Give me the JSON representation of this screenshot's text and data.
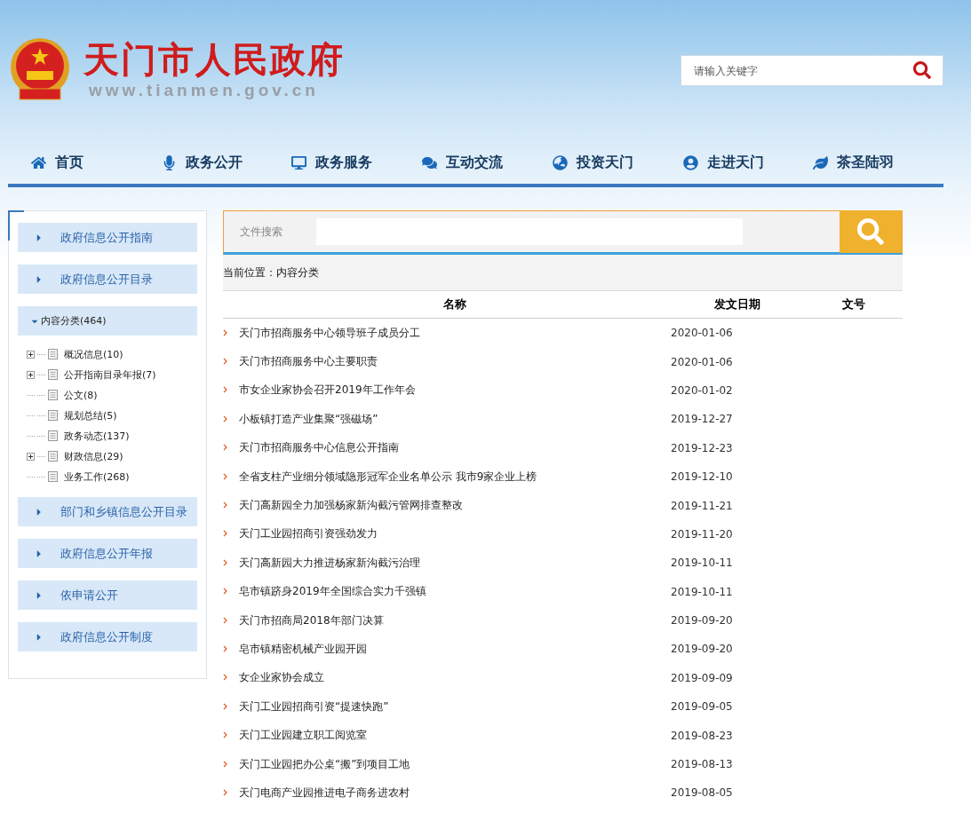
{
  "header": {
    "title": "天门市人民政府",
    "url": "www.tianmen.gov.cn",
    "search": {
      "placeholder": "请输入关键字"
    }
  },
  "nav": [
    {
      "label": "首页"
    },
    {
      "label": "政务公开"
    },
    {
      "label": "政务服务"
    },
    {
      "label": "互动交流"
    },
    {
      "label": "投资天门"
    },
    {
      "label": "走进天门"
    },
    {
      "label": "茶圣陆羽"
    }
  ],
  "sidebar": {
    "sections": [
      {
        "kind": "link",
        "label": "政府信息公开指南"
      },
      {
        "kind": "link",
        "label": "政府信息公开目录"
      },
      {
        "kind": "group",
        "label": "内容分类(464)",
        "expanded": true,
        "children": [
          {
            "label": "概况信息(10)",
            "kind": "folder"
          },
          {
            "label": "公开指南目录年报(7)",
            "kind": "folder"
          },
          {
            "label": "公文(8)",
            "kind": "leaf"
          },
          {
            "label": "规划总结(5)",
            "kind": "leaf"
          },
          {
            "label": "政务动态(137)",
            "kind": "leaf"
          },
          {
            "label": "财政信息(29)",
            "kind": "folder"
          },
          {
            "label": "业务工作(268)",
            "kind": "leaf"
          }
        ]
      },
      {
        "kind": "link",
        "label": "部门和乡镇信息公开目录"
      },
      {
        "kind": "link",
        "label": "政府信息公开年报"
      },
      {
        "kind": "link",
        "label": "依申请公开"
      },
      {
        "kind": "link",
        "label": "政府信息公开制度"
      }
    ]
  },
  "file_search": {
    "label": "文件搜索"
  },
  "breadcrumb": "当前位置：内容分类",
  "table": {
    "columns": [
      "名称",
      "发文日期",
      "文号"
    ],
    "rows": [
      {
        "title": "天门市招商服务中心领导班子成员分工",
        "date": "2020-01-06"
      },
      {
        "title": "天门市招商服务中心主要职责",
        "date": "2020-01-06"
      },
      {
        "title": "市女企业家协会召开2019年工作年会",
        "date": "2020-01-02"
      },
      {
        "title": "小板镇打造产业集聚“强磁场”",
        "date": "2019-12-27"
      },
      {
        "title": "天门市招商服务中心信息公开指南",
        "date": "2019-12-23"
      },
      {
        "title": "全省支柱产业细分领域隐形冠军企业名单公示 我市9家企业上榜",
        "date": "2019-12-10"
      },
      {
        "title": "天门高新园全力加强杨家新沟截污管网排查整改",
        "date": "2019-11-21"
      },
      {
        "title": "天门工业园招商引资强劲发力",
        "date": "2019-11-20"
      },
      {
        "title": "天门高新园大力推进杨家新沟截污治理",
        "date": "2019-10-11"
      },
      {
        "title": "皂市镇跻身2019年全国综合实力千强镇",
        "date": "2019-10-11"
      },
      {
        "title": "天门市招商局2018年部门决算",
        "date": "2019-09-20"
      },
      {
        "title": "皂市镇精密机械产业园开园",
        "date": "2019-09-20"
      },
      {
        "title": "女企业家协会成立",
        "date": "2019-09-09"
      },
      {
        "title": "天门工业园招商引资“提速快跑”",
        "date": "2019-09-05"
      },
      {
        "title": "天门工业园建立职工阅览室",
        "date": "2019-08-23"
      },
      {
        "title": "天门工业园把办公桌“搬”到项目工地",
        "date": "2019-08-13"
      },
      {
        "title": "天门电商产业园推进电子商务进农村",
        "date": "2019-08-05"
      }
    ]
  }
}
